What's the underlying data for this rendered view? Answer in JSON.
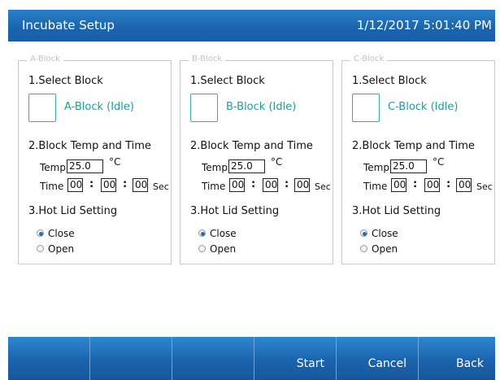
{
  "header": {
    "title": "Incubate Setup",
    "datetime": "1/12/2017 5:01:40 PM"
  },
  "blocks": [
    {
      "legend": "A-Block",
      "step1": "1.Select Block",
      "status": "A-Block (Idle)",
      "step2": "2.Block Temp and Time",
      "temp_label": "Temp",
      "temp_value": "25.0",
      "temp_unit": "°C",
      "time_label": "Time",
      "hh": "00",
      "mm": "00",
      "ss": "00",
      "sec_label": "Sec",
      "step3": "3.Hot Lid Setting",
      "close_label": "Close",
      "open_label": "Open",
      "lid_selected": "Close"
    },
    {
      "legend": "B-Block",
      "step1": "1.Select Block",
      "status": "B-Block (Idle)",
      "step2": "2.Block Temp and Time",
      "temp_label": "Temp",
      "temp_value": "25.0",
      "temp_unit": "°C",
      "time_label": "Time",
      "hh": "00",
      "mm": "00",
      "ss": "00",
      "sec_label": "Sec",
      "step3": "3.Hot Lid Setting",
      "close_label": "Close",
      "open_label": "Open",
      "lid_selected": "Close"
    },
    {
      "legend": "C-Block",
      "step1": "1.Select Block",
      "status": "C-Block (Idle)",
      "step2": "2.Block Temp and Time",
      "temp_label": "Temp",
      "temp_value": "25.0",
      "temp_unit": "°C",
      "time_label": "Time",
      "hh": "00",
      "mm": "00",
      "ss": "00",
      "sec_label": "Sec",
      "step3": "3.Hot Lid Setting",
      "close_label": "Close",
      "open_label": "Open",
      "lid_selected": "Close"
    }
  ],
  "footer": {
    "buttons": [
      "",
      "",
      "",
      "Start",
      "Cancel",
      "Back"
    ]
  }
}
